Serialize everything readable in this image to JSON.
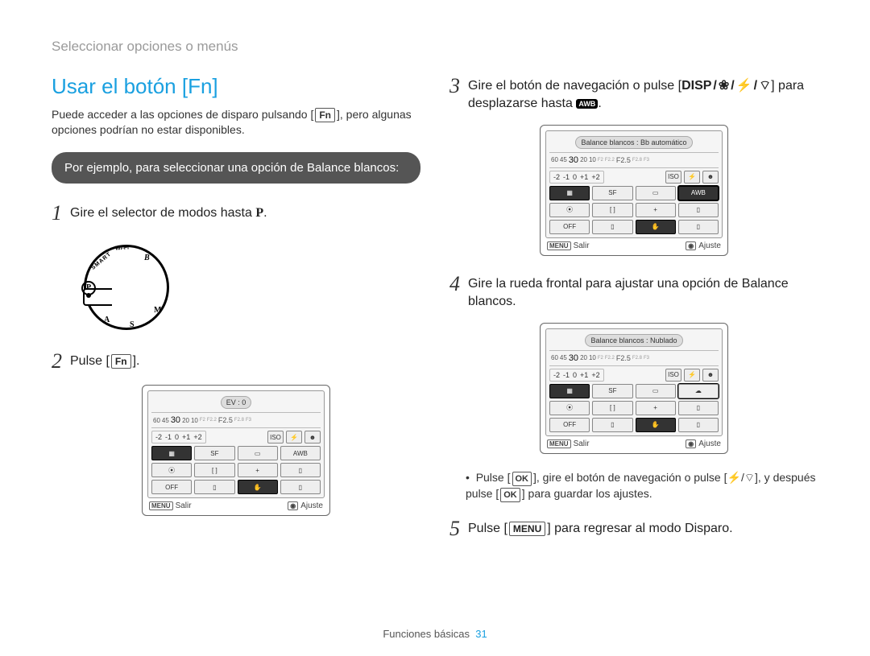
{
  "breadcrumb": "Seleccionar opciones o menús",
  "section_title": "Usar el botón [Fn]",
  "intro_pre": "Puede acceder a las opciones de disparo pulsando [",
  "intro_key": "Fn",
  "intro_post": "], pero algunas opciones podrían no estar disponibles.",
  "pill": "Por ejemplo, para seleccionar una opción de Balance blancos:",
  "steps": {
    "s1": {
      "num": "1",
      "pre": "Gire el selector de modos hasta ",
      "modeKey": "P",
      "post": "."
    },
    "s2": {
      "num": "2",
      "pre": "Pulse [",
      "key": "Fn",
      "post": "]."
    },
    "s3": {
      "num": "3",
      "pre": "Gire el botón de navegación o pulse [",
      "disp": "DISP",
      "post_a": "] para desplazarse hasta ",
      "awb": "AWB",
      "post_b": "."
    },
    "s4": {
      "num": "4",
      "text": "Gire la rueda frontal para ajustar una opción de Balance blancos."
    },
    "s5": {
      "num": "5",
      "pre": "Pulse [",
      "key": "MENU",
      "post": "] para regresar al modo Disparo."
    }
  },
  "note": {
    "pre": "Pulse [",
    "ok1": "OK",
    "mid1": "], gire el botón de navegación o pulse [",
    "mid2": "], y después pulse [",
    "ok2": "OK",
    "post": "] para guardar los ajustes."
  },
  "screen": {
    "ev_label": "EV : 0",
    "wb_auto": "Balance blancos : Bb automático",
    "wb_nub": "Balance blancos : Nublado",
    "scale": {
      "v60": "60",
      "v45": "45",
      "v30": "30",
      "v20": "20",
      "v10": "10",
      "f2": "F2",
      "f22": "F2.2",
      "f25": "F2.5",
      "f28": "F2.8",
      "f3": "F3"
    },
    "ev": {
      "nm2": "-2",
      "nm1": "-1",
      "z": "0",
      "p1": "+1",
      "p2": "+2"
    },
    "exit": "Salir",
    "adjust": "Ajuste",
    "menu": "MENU"
  },
  "footer": {
    "label": "Funciones básicas",
    "page": "31"
  },
  "dial": {
    "smart": "SMART",
    "wifi": "Wi-Fi",
    "P": "P",
    "B": "B",
    "M": "M",
    "S": "S",
    "A": "A"
  },
  "icons": {
    "flower": "❀",
    "flash": "⚡",
    "wifi": "⌔",
    "cloud": "☁",
    "hand": "✋",
    "face": "☻",
    "plus": "+",
    "dial": "◉"
  }
}
